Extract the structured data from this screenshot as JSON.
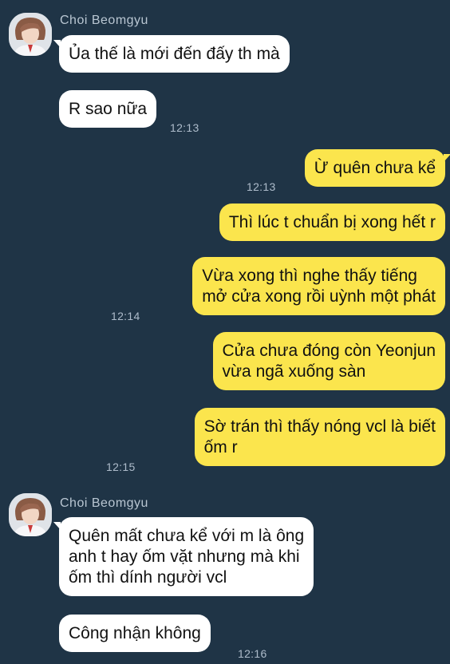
{
  "chat": {
    "accent_color": "#fbe54d",
    "background_color": "#1f3446",
    "groups": [
      {
        "sender": "Choi Beomgyu",
        "messages": [
          {
            "text": "Ủa thế là mới đến đấy th mà"
          },
          {
            "text": "R sao nữa",
            "time": "12:13"
          }
        ]
      },
      {
        "sender": "me",
        "messages": [
          {
            "text": "Ừ quên chưa kể",
            "time": "12:13"
          },
          {
            "text": "Thì lúc t chuẩn bị xong hết r"
          },
          {
            "lines": [
              "Vừa xong thì nghe thấy tiếng",
              "mở cửa xong rồi uỳnh một phát"
            ],
            "time": "12:14"
          },
          {
            "lines": [
              "Cửa chưa đóng còn Yeonjun",
              "vừa ngã xuống sàn"
            ]
          },
          {
            "lines": [
              "Sờ trán thì thấy nóng vcl là biết",
              "ốm r"
            ],
            "time": "12:15"
          }
        ]
      },
      {
        "sender": "Choi Beomgyu",
        "messages": [
          {
            "lines": [
              "Quên mất chưa kể với m là ông",
              "anh t hay ốm vặt nhưng mà khi",
              "ốm thì dính người vcl"
            ]
          },
          {
            "text": "Công nhận không",
            "time": "12:16"
          }
        ]
      }
    ]
  }
}
